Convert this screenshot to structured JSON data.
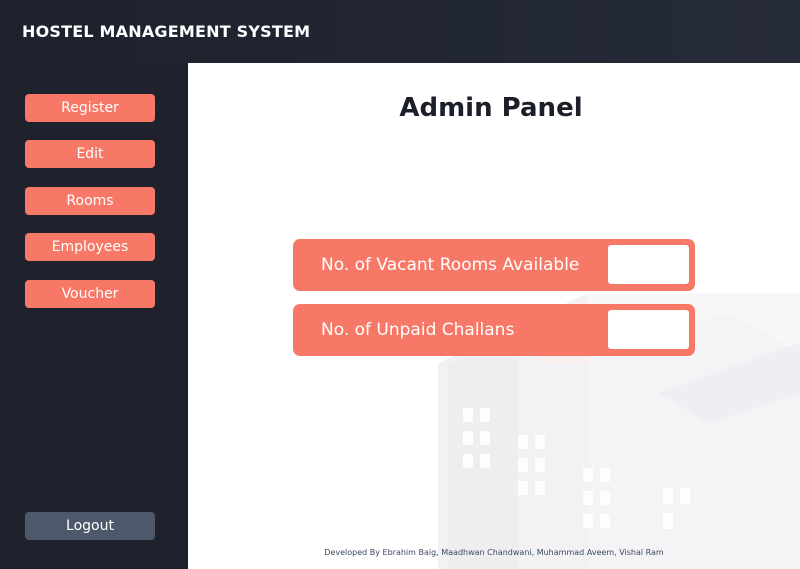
{
  "header": {
    "title": "HOSTEL MANAGEMENT SYSTEM"
  },
  "sidebar": {
    "items": [
      {
        "label": "Register"
      },
      {
        "label": "Edit"
      },
      {
        "label": "Rooms"
      },
      {
        "label": "Employees"
      },
      {
        "label": "Voucher"
      }
    ],
    "logout_label": "Logout"
  },
  "main": {
    "title": "Admin Panel",
    "stats": [
      {
        "label": "No. of Vacant Rooms Available",
        "value": ""
      },
      {
        "label": "No. of Unpaid Challans",
        "value": ""
      }
    ],
    "footer": "Developed By Ebrahim Baig, Maadhwan Chandwani, Muhammad Aveem, Vishal Ram"
  },
  "colors": {
    "header_bg": "#1d212c",
    "sidebar_bg": "#1f222c",
    "accent": "#f77866",
    "logout_bg": "#4e586b",
    "title_text": "#1c1f2a"
  }
}
